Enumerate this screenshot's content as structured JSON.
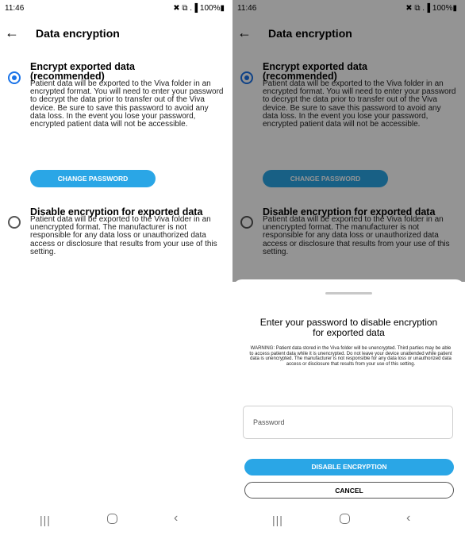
{
  "status_bar": {
    "time": "11:46",
    "indicators": "✖ ⧉ .▐ 100%▮"
  },
  "app_bar": {
    "back_glyph": "←",
    "title": "Data encryption"
  },
  "encrypt_option": {
    "title_line1": "Encrypt exported data",
    "title_line2": "(recommended)",
    "description": "Patient data will be exported to the Viva folder in an encrypted format. You will need to enter your password to decrypt the data prior to transfer out of the Viva device. Be sure to save this password to avoid any data loss. In the event you lose your password, encrypted patient data will not be accessible.",
    "selected": true
  },
  "change_password_label": "CHANGE PASSWORD",
  "disable_option": {
    "title": "Disable encryption for exported data",
    "description": "Patient data will be exported to the Viva folder in an unencrypted format. The manufacturer is not responsible for any data loss or unauthorized data access or disclosure that results from your use of this setting.",
    "selected": false
  },
  "dialog": {
    "title": "Enter your password to disable encryption for exported data",
    "warning": "WARNING: Patient data stored in the Viva folder will be unencrypted. Third parties may be able to access patient data while it is unencrypted. Do not leave your device unattended while patient data is unencrypted. The manufacturer is not responsible for any data loss or unauthorized data access or disclosure that results from your use of this setting.",
    "password_placeholder": "Password",
    "disable_label": "DISABLE ENCRYPTION",
    "cancel_label": "CANCEL"
  },
  "nav_bar": {
    "recent_glyph": "|||",
    "back_glyph": "‹"
  },
  "icons": [
    "back-arrow-icon",
    "radio-selected-icon",
    "radio-unselected-icon",
    "recent-apps-icon",
    "home-icon",
    "nav-back-icon",
    "mute-icon",
    "wifi-icon",
    "signal-icon",
    "battery-icon"
  ],
  "colors": {
    "accent": "#2aa6e6",
    "radio_selected": "#1a73e8",
    "scrim": "rgba(0,0,0,0.42)"
  }
}
